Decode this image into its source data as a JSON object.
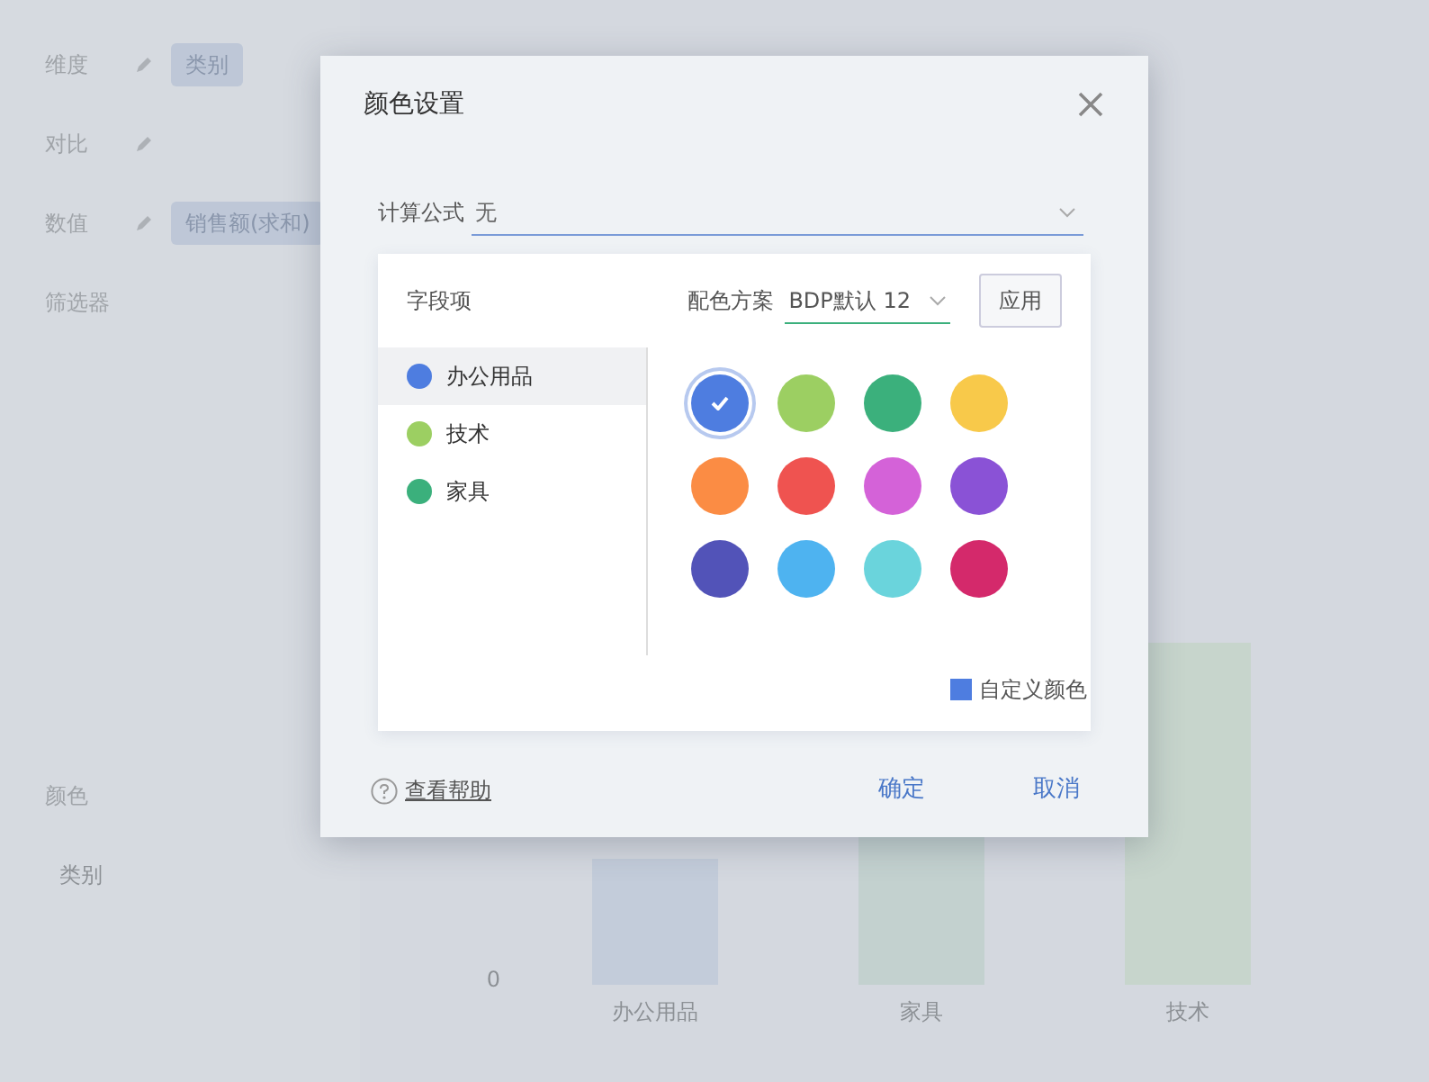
{
  "background": {
    "shelves": [
      {
        "label": "维度",
        "chips": [
          "类别"
        ]
      },
      {
        "label": "对比"
      },
      {
        "label": "数值",
        "chips": [
          "销售额(求和)"
        ]
      }
    ],
    "filter_label": "筛选器",
    "color_label": "颜色",
    "color_field": "类别",
    "chart": {
      "y_tick": "0",
      "categories": [
        "办公用品",
        "家具",
        "技术"
      ]
    }
  },
  "dialog": {
    "title": "颜色设置",
    "formula": {
      "label": "计算公式",
      "value": "无"
    },
    "field_header": "字段项",
    "scheme": {
      "label": "配色方案",
      "value": "BDP默认 12",
      "apply": "应用"
    },
    "fields": [
      {
        "label": "办公用品",
        "color": "#4e7de0",
        "selected": true
      },
      {
        "label": "技术",
        "color": "#9ccf62",
        "selected": false
      },
      {
        "label": "家具",
        "color": "#3bb07c",
        "selected": false
      }
    ],
    "swatches": [
      {
        "color": "#4e7de0",
        "selected": true
      },
      {
        "color": "#9ccf62",
        "selected": false
      },
      {
        "color": "#3bb07c",
        "selected": false
      },
      {
        "color": "#f8c94a",
        "selected": false
      },
      {
        "color": "#fb8c44",
        "selected": false
      },
      {
        "color": "#ef5350",
        "selected": false
      },
      {
        "color": "#d462d8",
        "selected": false
      },
      {
        "color": "#8a52d6",
        "selected": false
      },
      {
        "color": "#5253b8",
        "selected": false
      },
      {
        "color": "#4eb3f0",
        "selected": false
      },
      {
        "color": "#6ad4dc",
        "selected": false
      },
      {
        "color": "#d4296b",
        "selected": false
      }
    ],
    "custom_color": "自定义颜色",
    "help": "查看帮助",
    "ok": "确定",
    "cancel": "取消"
  }
}
